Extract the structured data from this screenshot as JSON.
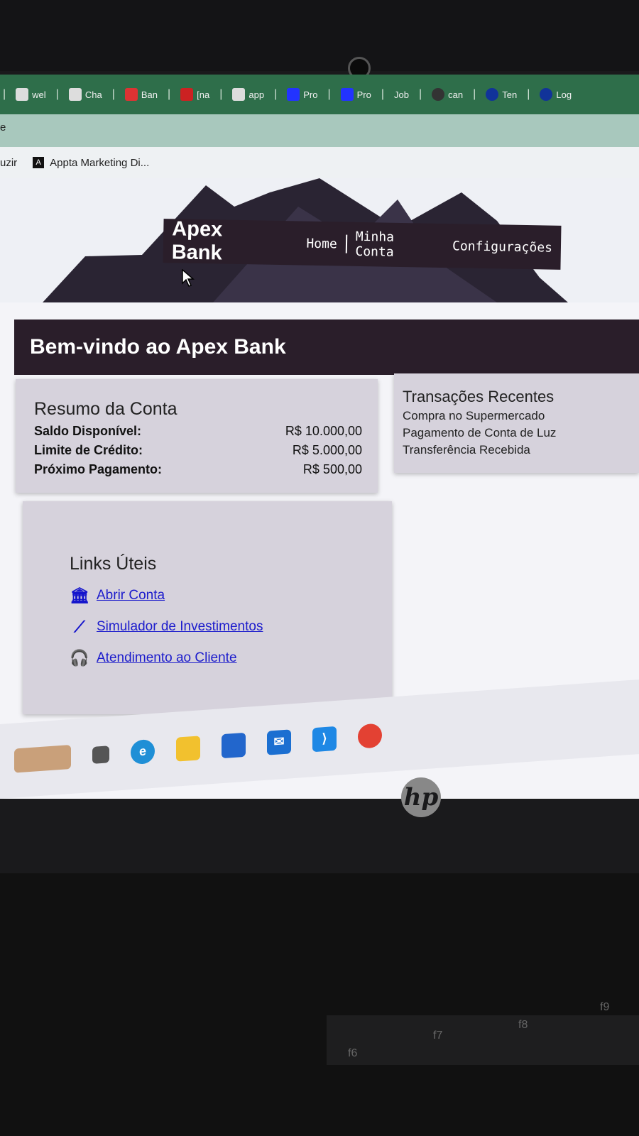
{
  "browser": {
    "tabs": [
      {
        "label": "wel",
        "icon": "github-icon"
      },
      {
        "label": "Cha",
        "icon": "chatgpt-icon"
      },
      {
        "label": "Ban",
        "icon": "gmail-icon"
      },
      {
        "label": "[na",
        "icon": "page-icon"
      },
      {
        "label": "app",
        "icon": "app-icon"
      },
      {
        "label": "Pro",
        "icon": "pro-icon"
      },
      {
        "label": "Pro",
        "icon": "pro-icon"
      },
      {
        "label": "Job",
        "icon": "job-icon"
      },
      {
        "label": "can",
        "icon": "can-icon"
      },
      {
        "label": "Ten",
        "icon": "ten-icon"
      },
      {
        "label": "Log",
        "icon": "log-icon"
      }
    ],
    "url_text": "e",
    "bookmarks": [
      {
        "label": "uzir"
      },
      {
        "label": "Appta Marketing Di...",
        "icon": "A"
      }
    ]
  },
  "site": {
    "brand": "Apex Bank",
    "nav": [
      "Home",
      "Minha Conta",
      "Configurações"
    ],
    "welcome": "Bem-vindo ao Apex Bank",
    "summary": {
      "title": "Resumo da Conta",
      "rows": [
        {
          "label": "Saldo Disponível:",
          "value": "R$ 10.000,00"
        },
        {
          "label": "Limite de Crédito:",
          "value": "R$ 5.000,00"
        },
        {
          "label": "Próximo Pagamento:",
          "value": "R$ 500,00"
        }
      ]
    },
    "transactions": {
      "title": "Transações Recentes",
      "items": [
        "Compra no Supermercado",
        "Pagamento de Conta de Luz",
        "Transferência Recebida"
      ]
    },
    "links": {
      "title": "Links Úteis",
      "items": [
        {
          "label": "Abrir Conta",
          "icon": "bank-icon"
        },
        {
          "label": "Simulador de Investimentos",
          "icon": "chart-line-icon"
        },
        {
          "label": "Atendimento ao Cliente",
          "icon": "headset-icon"
        }
      ]
    }
  },
  "taskbar": {
    "icons": [
      "task-view-icon",
      "edge-icon",
      "file-explorer-icon",
      "store-icon",
      "mail-icon",
      "vscode-icon",
      "chrome-icon"
    ]
  },
  "device": {
    "logo": "hp",
    "keys": [
      "f6",
      "f7",
      "f8",
      "f9"
    ]
  }
}
